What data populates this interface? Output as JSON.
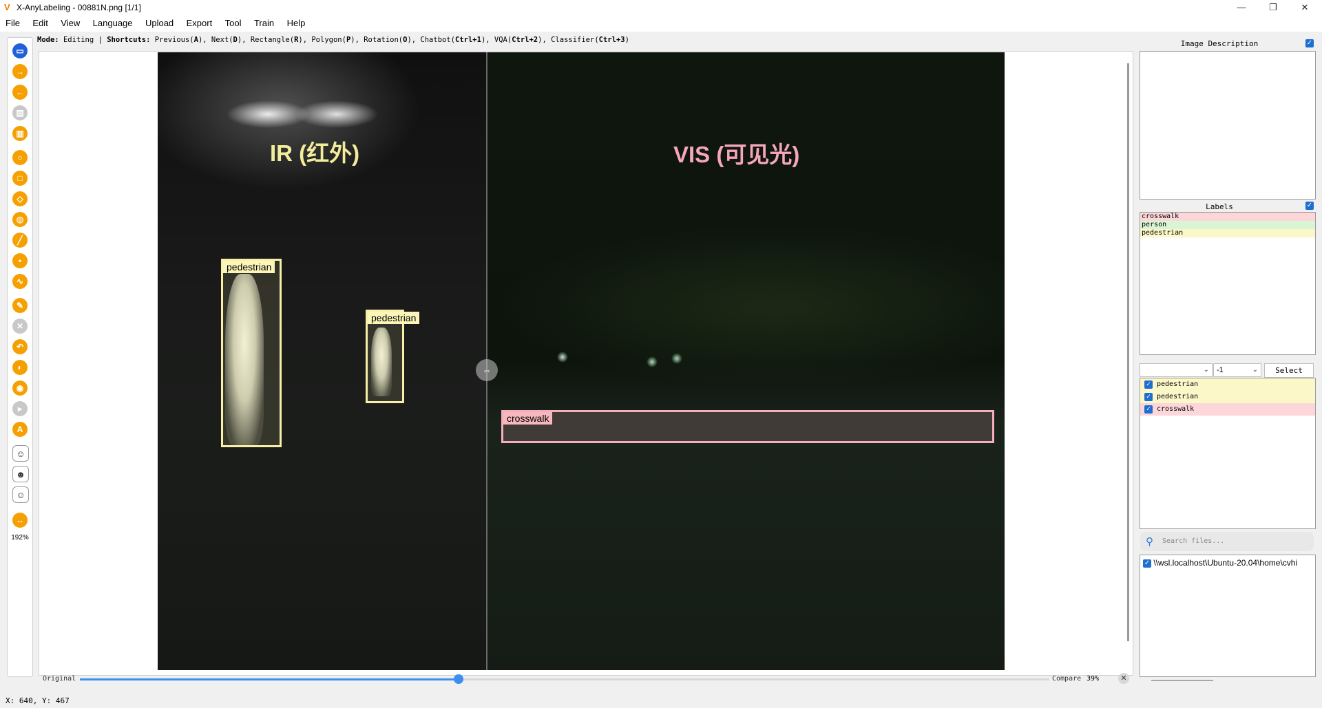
{
  "window": {
    "title": "X-AnyLabeling - 00881N.png [1/1]",
    "minimize": "—",
    "maximize": "❐",
    "close": "✕"
  },
  "menu": [
    "File",
    "Edit",
    "View",
    "Language",
    "Upload",
    "Export",
    "Tool",
    "Train",
    "Help"
  ],
  "modebar": {
    "mode_key": "Mode:",
    "mode_val": "Editing",
    "sep": "|",
    "shortcuts_key": "Shortcuts:",
    "prev": "Previous(",
    "prev_key": "A",
    "next": "), Next(",
    "next_key": "D",
    "rect": "), Rectangle(",
    "rect_key": "R",
    "poly": "), Polygon(",
    "poly_key": "P",
    "rot": "), Rotation(",
    "rot_key": "O",
    "chat": "), Chatbot(",
    "chat_key": "Ctrl+1",
    "vqa": "), VQA(",
    "vqa_key": "Ctrl+2",
    "cls": "), Classifier(",
    "cls_key": "Ctrl+3",
    "end": ")"
  },
  "toolbar": {
    "zoom": "192%"
  },
  "image": {
    "ir_title": "IR (红外)",
    "vis_title": "VIS (可见光)",
    "boxes": [
      {
        "label": "pedestrian"
      },
      {
        "label": "pedestrian"
      },
      {
        "label": "crosswalk"
      }
    ]
  },
  "slider": {
    "left_label": "Original",
    "right_label": "Compare",
    "value_text": "39%",
    "value": 0.39,
    "close": "✕"
  },
  "status": {
    "coords": "X: 640, Y: 467"
  },
  "right_panel": {
    "description_title": "Image Description",
    "labels_title": "Labels",
    "labels": [
      {
        "name": "crosswalk",
        "color": "#fcd6d9"
      },
      {
        "name": "person",
        "color": "#d8f6d4"
      },
      {
        "name": "pedestrian",
        "color": "#fbf7c8"
      }
    ],
    "filter_left": "",
    "filter_right": "-1",
    "select_label": "Select",
    "shapes": [
      {
        "name": "pedestrian",
        "color": "#fbf7c8"
      },
      {
        "name": "pedestrian",
        "color": "#fbf7c8"
      },
      {
        "name": "crosswalk",
        "color": "#fcd6d9"
      }
    ],
    "search_placeholder": "Search files...",
    "file": "\\\\wsl.localhost\\Ubuntu-20.04\\home\\cvhi"
  },
  "colors": {
    "accent": "#f5a000",
    "pedestrian_box": "#f8f0a8",
    "crosswalk_box": "#f4b0b8",
    "checkbox": "#1f6fd0",
    "slider": "#3b8ff0"
  }
}
